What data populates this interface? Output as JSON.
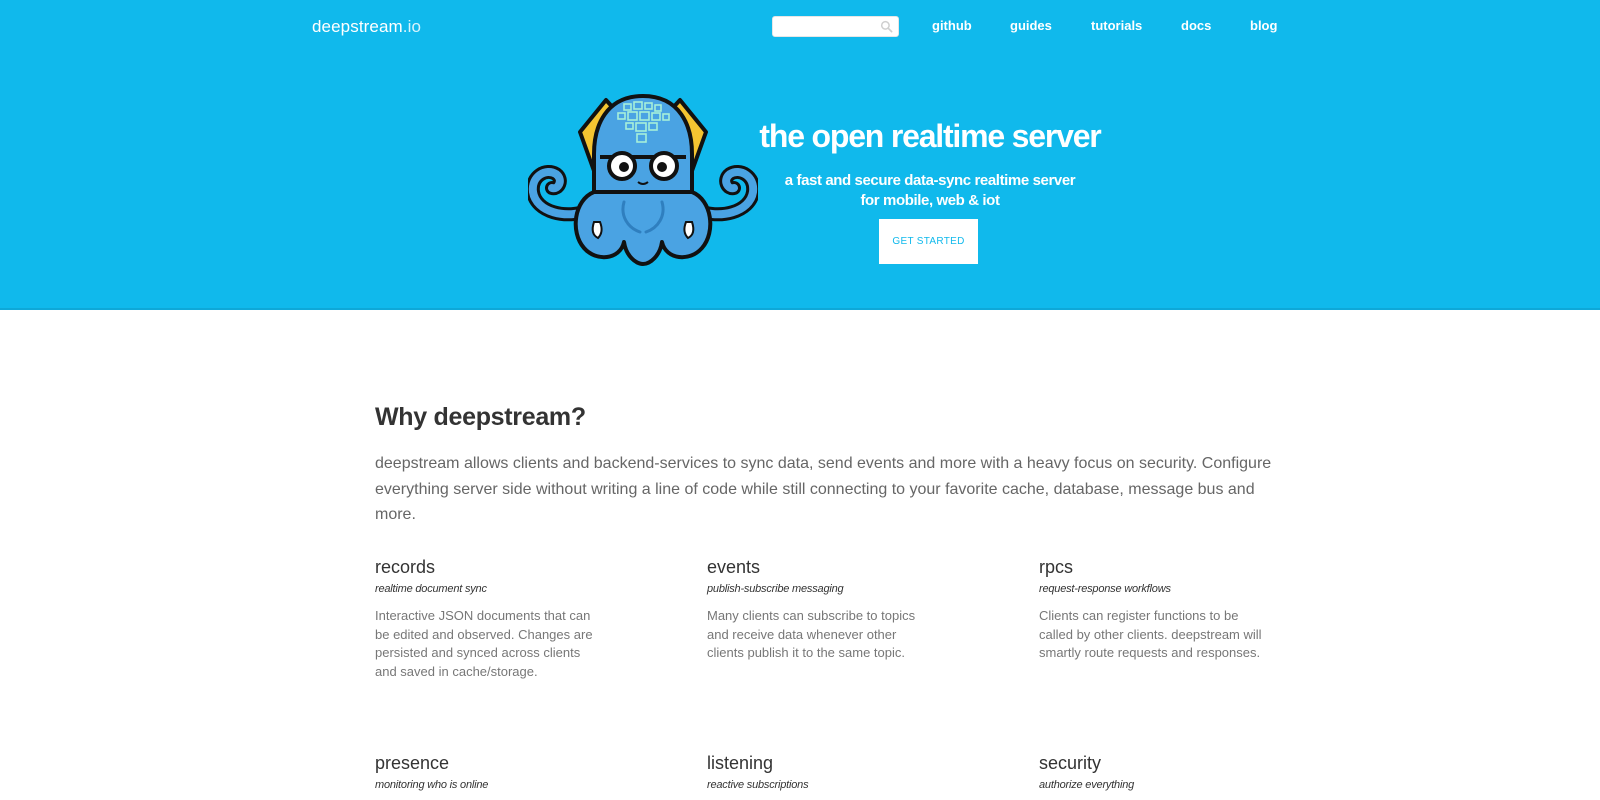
{
  "header": {
    "logo_main": "deepstream",
    "logo_tld": ".io",
    "search": {
      "placeholder": "",
      "value": "",
      "icon": "search-icon"
    },
    "nav": [
      {
        "label": "github"
      },
      {
        "label": "guides"
      },
      {
        "label": "tutorials"
      },
      {
        "label": "docs"
      },
      {
        "label": "blog"
      }
    ]
  },
  "hero": {
    "title": "the open realtime server",
    "subtitle_line1": "a fast and secure data-sync realtime server",
    "subtitle_line2": "for mobile, web & iot",
    "cta_label": "GET STARTED",
    "mascot": "octopus-mascot-with-glasses"
  },
  "why": {
    "title": "Why deepstream?",
    "intro": "deepstream allows clients and backend-services to sync data, send events and more with a heavy focus on security. Configure everything server side without writing a line of code while still connecting to your favorite cache, database, message bus and more."
  },
  "features": [
    {
      "title": "records",
      "subtitle": "realtime document sync",
      "description": "Interactive JSON documents that can be edited and observed. Changes are persisted and synced across clients and saved in cache/storage."
    },
    {
      "title": "events",
      "subtitle": "publish-subscribe messaging",
      "description": "Many clients can subscribe to topics and receive data whenever other clients publish it to the same topic."
    },
    {
      "title": "rpcs",
      "subtitle": "request-response workflows",
      "description": "Clients can register functions to be called by other clients. deepstream will smartly route requests and responses."
    },
    {
      "title": "presence",
      "subtitle": "monitoring who is online",
      "description": ""
    },
    {
      "title": "listening",
      "subtitle": "reactive subscriptions",
      "description": ""
    },
    {
      "title": "security",
      "subtitle": "authorize everything",
      "description": ""
    }
  ],
  "colors": {
    "brand_blue": "#10b9ec",
    "text_dark": "#333333",
    "text_muted": "#777777"
  }
}
